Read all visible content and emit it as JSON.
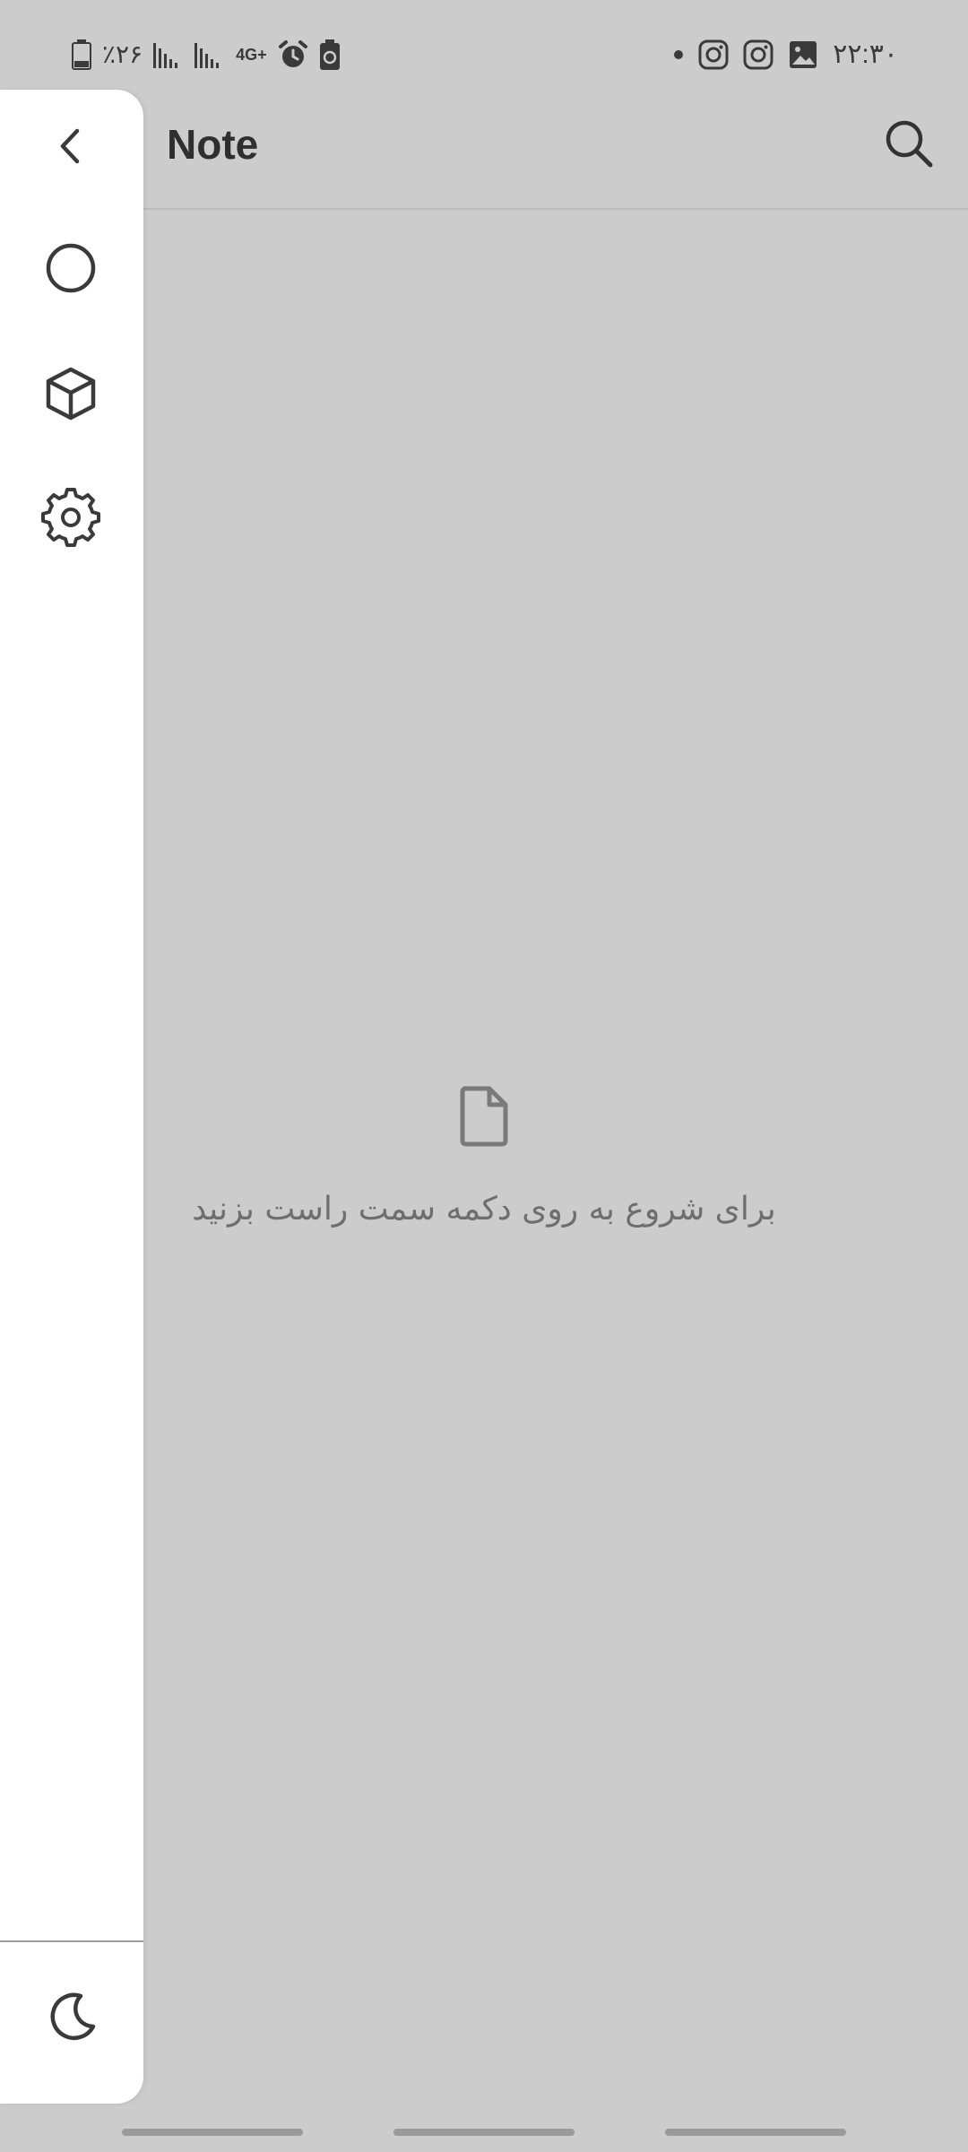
{
  "status_bar": {
    "battery": "٪۲۶",
    "network": "4G+",
    "time": "۲۲:۳۰"
  },
  "app_bar": {
    "title": "Note"
  },
  "empty_state": {
    "message": "برای شروع به روی دکمه سمت راست بزنید"
  },
  "drawer": {
    "items": [
      {
        "icon": "chevron-left-icon"
      },
      {
        "icon": "circle-icon"
      },
      {
        "icon": "cube-icon"
      },
      {
        "icon": "gear-icon"
      }
    ],
    "bottom_icon": "moon-icon"
  },
  "colors": {
    "background": "#cccccc",
    "drawer": "#ffffff",
    "text": "#3a3a3a",
    "muted_text": "#6e6e6e"
  }
}
